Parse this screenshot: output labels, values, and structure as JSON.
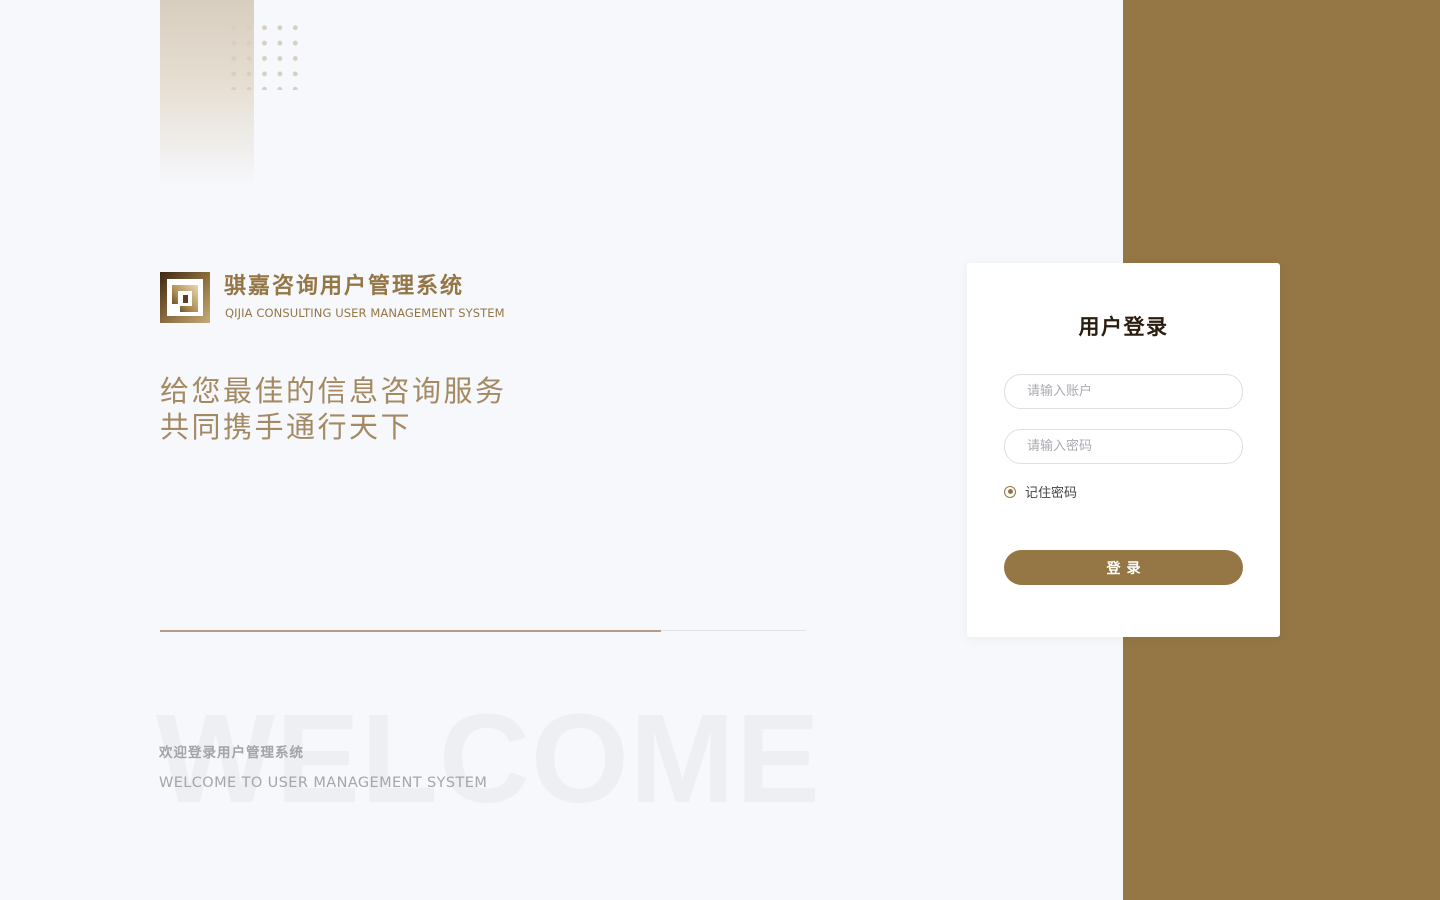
{
  "brand": {
    "title": "骐嘉咨询用户管理系统",
    "subtitle": "QIJIA CONSULTING USER MANAGEMENT SYSTEM",
    "logo_icon": "qijia-logo-icon"
  },
  "slogan": {
    "line1": "给您最佳的信息咨询服务",
    "line2": "共同携手通行天下"
  },
  "progress": {
    "fraction": 0.775
  },
  "welcome": {
    "watermark": "WELCOME",
    "cn": "欢迎登录用户管理系统",
    "en": "WELCOME TO USER MANAGEMENT SYSTEM"
  },
  "login": {
    "title": "用户登录",
    "username_placeholder": "请输入账户",
    "username_value": "",
    "password_placeholder": "请输入密码",
    "password_value": "",
    "remember_label": "记住密码",
    "remember_checked": true,
    "submit_label": "登录"
  },
  "colors": {
    "accent": "#957645",
    "background": "#f6f8fc",
    "card": "#ffffff",
    "progress": "#b79b8a"
  }
}
